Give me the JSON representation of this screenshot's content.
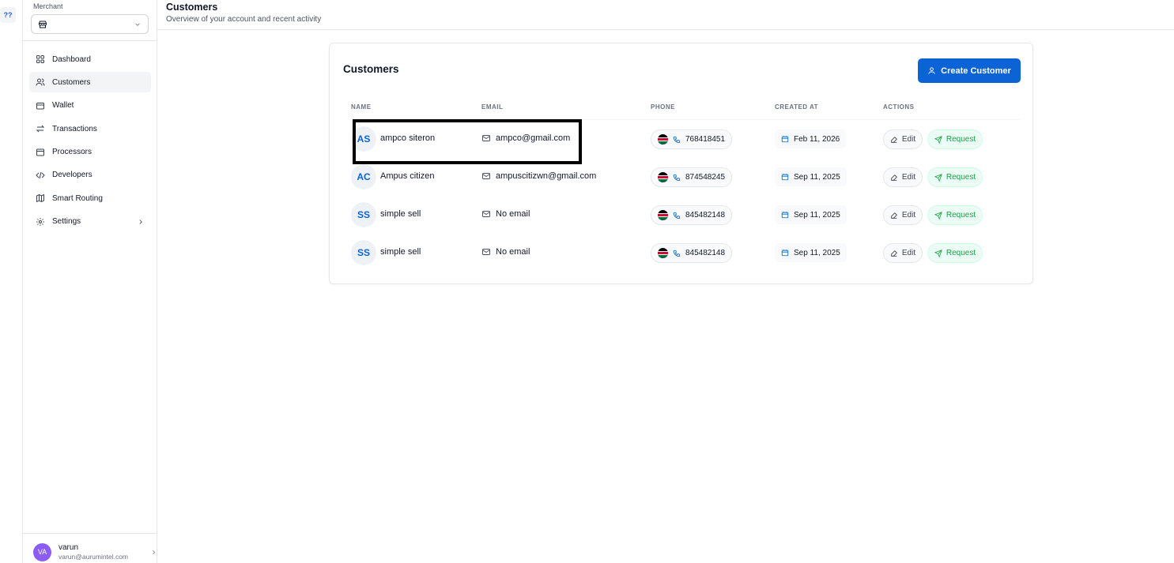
{
  "rail": {
    "badge": "??"
  },
  "sidebar": {
    "merchant_label": "Merchant",
    "merchant_value": "",
    "items": [
      {
        "label": "Dashboard",
        "icon": "grid-icon",
        "active": false
      },
      {
        "label": "Customers",
        "icon": "users-icon",
        "active": true
      },
      {
        "label": "Wallet",
        "icon": "wallet-icon",
        "active": false
      },
      {
        "label": "Transactions",
        "icon": "arrows-icon",
        "active": false
      },
      {
        "label": "Processors",
        "icon": "processor-icon",
        "active": false
      },
      {
        "label": "Developers",
        "icon": "code-icon",
        "active": false
      },
      {
        "label": "Smart Routing",
        "icon": "map-icon",
        "active": false
      },
      {
        "label": "Settings",
        "icon": "gear-icon",
        "active": false
      }
    ],
    "user": {
      "initials": "VA",
      "name": "varun",
      "email": "varun@aurumintel.com"
    }
  },
  "header": {
    "title": "Customers",
    "subtitle": "Overview of your account and recent activity"
  },
  "card": {
    "title": "Customers",
    "create_label": "Create Customer",
    "columns": {
      "name": "NAME",
      "email": "EMAIL",
      "phone": "PHONE",
      "created": "CREATED AT",
      "actions": "ACTIONS"
    },
    "rows": [
      {
        "initials": "AS",
        "name": "ampco siteron",
        "email": "ampco@gmail.com",
        "phone": "768418451",
        "created": "Feb 11, 2026",
        "edit": "Edit",
        "request": "Request"
      },
      {
        "initials": "AC",
        "name": "Ampus citizen",
        "email": "ampuscitizwn@gmail.com",
        "phone": "874548245",
        "created": "Sep 11, 2025",
        "edit": "Edit",
        "request": "Request"
      },
      {
        "initials": "SS",
        "name": "simple sell",
        "email": "No email",
        "phone": "845482148",
        "created": "Sep 11, 2025",
        "edit": "Edit",
        "request": "Request"
      },
      {
        "initials": "SS",
        "name": "simple sell",
        "email": "No email",
        "phone": "845482148",
        "created": "Sep 11, 2025",
        "edit": "Edit",
        "request": "Request"
      }
    ]
  },
  "colors": {
    "accent": "#0b63d6",
    "success": "#16a34a",
    "avatar_user": "#8b5cf6"
  }
}
